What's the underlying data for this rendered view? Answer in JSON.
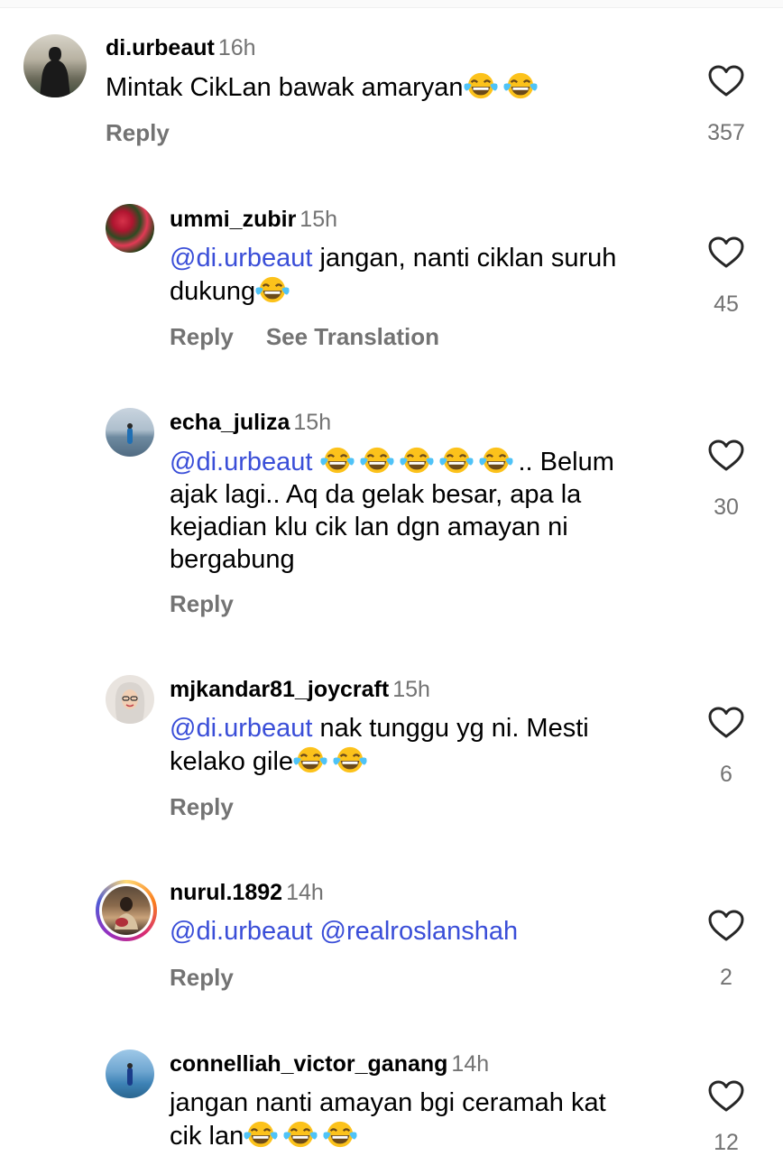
{
  "comments": [
    {
      "username": "di.urbeaut",
      "time": "16h",
      "text_parts": [
        "Mintak CikLan bawak amaryan"
      ],
      "emoji_count": 2,
      "actions": [
        "Reply"
      ],
      "likes": "357"
    },
    {
      "username": "ummi_zubir",
      "time": "15h",
      "mention": "@di.urbeaut",
      "text_parts": [
        " jangan, nanti ciklan suruh",
        "dukung"
      ],
      "emoji_count": 1,
      "actions": [
        "Reply",
        "See Translation"
      ],
      "likes": "45"
    },
    {
      "username": "echa_juliza",
      "time": "15h",
      "mention": "@di.urbeaut",
      "text_parts": [
        "..",
        " Belum",
        "ajak lagi.. Aq da gelak besar, apa la",
        "kejadian klu cik lan dgn amayan ni",
        "bergabung"
      ],
      "emoji_count": 5,
      "actions": [
        "Reply"
      ],
      "likes": "30"
    },
    {
      "username": "mjkandar81_joycraft",
      "time": "15h",
      "mention": "@di.urbeaut",
      "text_parts": [
        " nak tunggu yg ni. Mesti",
        "kelako gile"
      ],
      "emoji_count": 2,
      "actions": [
        "Reply"
      ],
      "likes": "6"
    },
    {
      "username": "nurul.1892",
      "time": "14h",
      "mention": "@di.urbeaut",
      "mention2": "@realroslanshah",
      "actions": [
        "Reply"
      ],
      "likes": "2"
    },
    {
      "username": "connelliah_victor_ganang",
      "time": "14h",
      "text_parts": [
        "jangan nanti amayan bgi ceramah kat",
        "cik lan"
      ],
      "emoji_count": 3,
      "likes": "12"
    }
  ],
  "icons": {
    "like": "heart-outline-icon",
    "emoji": "face-with-tears-of-joy-emoji"
  },
  "colors": {
    "mention": "#3a4ed8",
    "secondary_text": "#737373"
  }
}
